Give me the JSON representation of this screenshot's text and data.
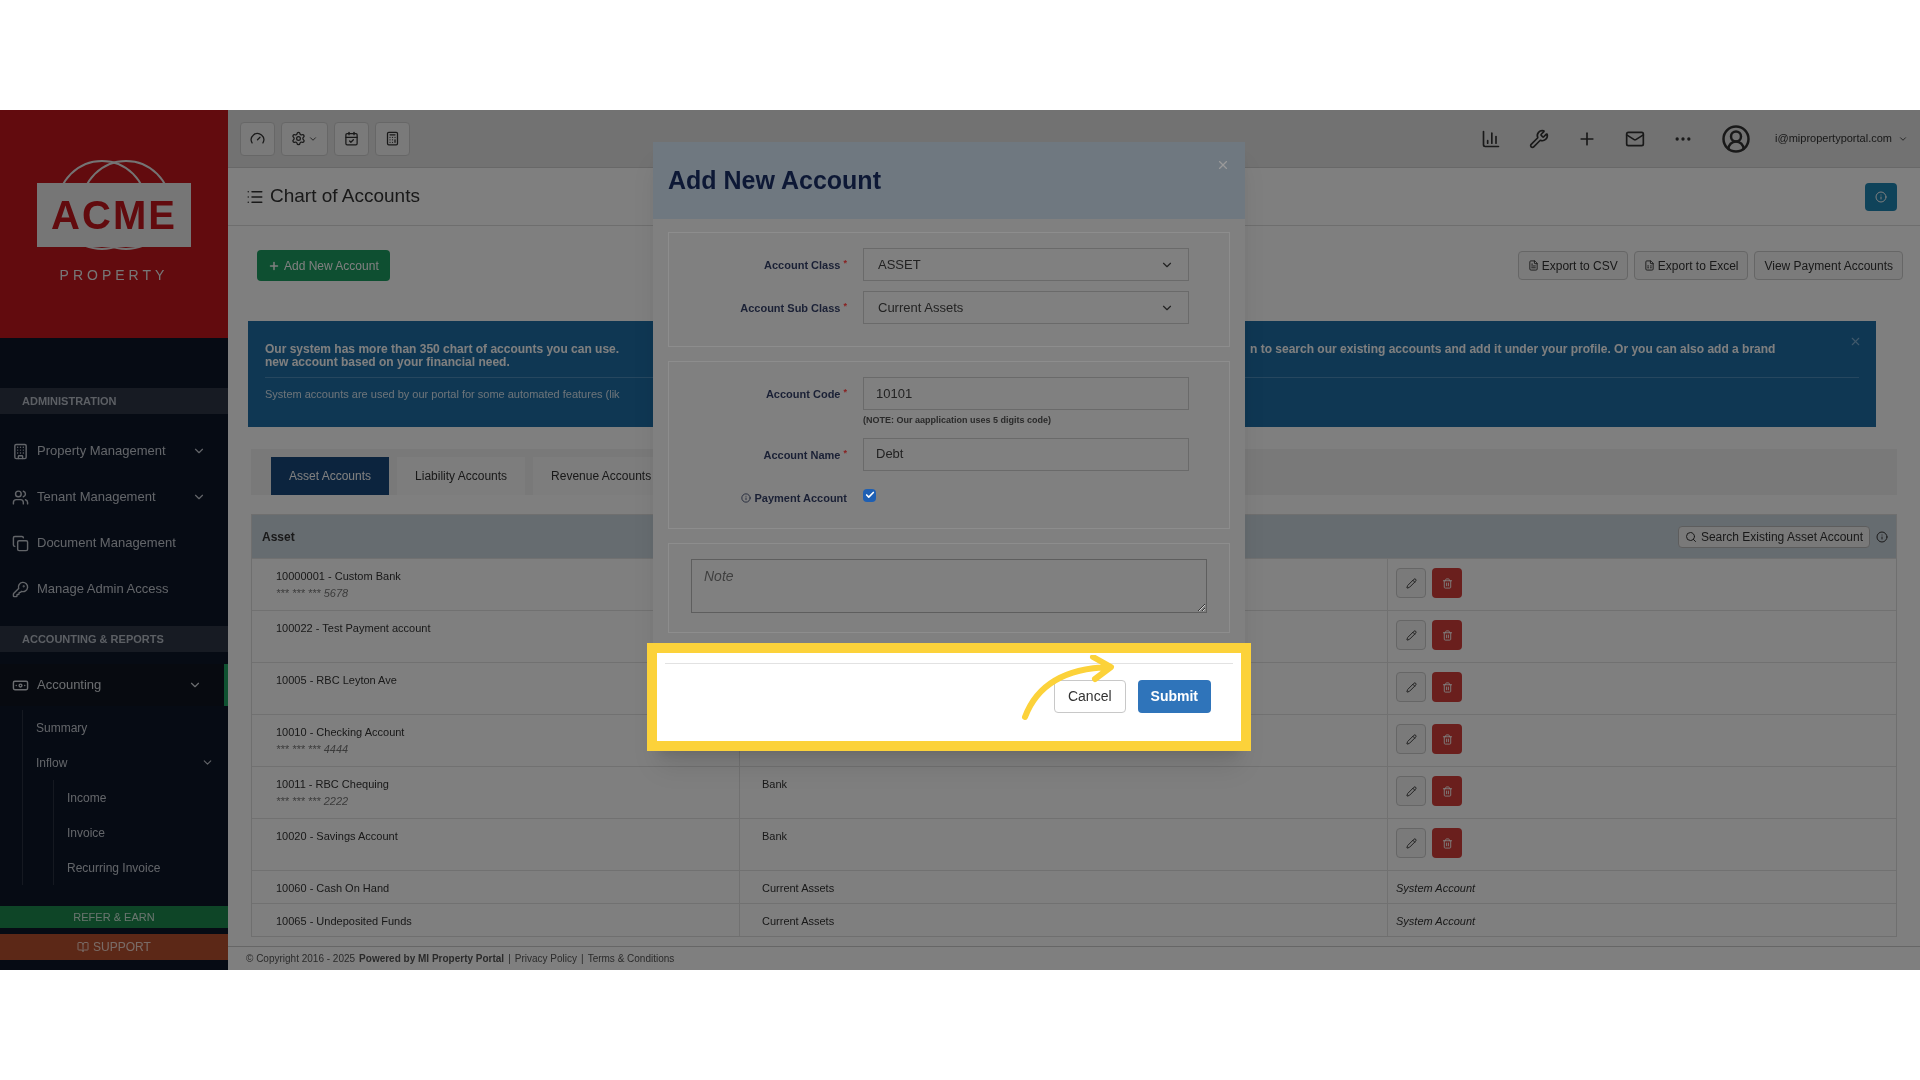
{
  "brand": {
    "name": "ACME",
    "tagline": "PROPERTY"
  },
  "sidebar": {
    "sections": [
      {
        "title": "ADMINISTRATION",
        "items": [
          {
            "label": "Property Management",
            "expandable": true,
            "selected": false
          },
          {
            "label": "Tenant Management",
            "expandable": true,
            "selected": false
          },
          {
            "label": "Document Management",
            "selected": false
          },
          {
            "label": "Manage Admin Access",
            "selected": false
          }
        ]
      },
      {
        "title": "ACCOUNTING & REPORTS",
        "items": [
          {
            "label": "Accounting",
            "expandable": true,
            "selected": true,
            "children": [
              {
                "label": "Summary"
              },
              {
                "label": "Inflow",
                "expandable": true,
                "children": [
                  {
                    "label": "Income"
                  },
                  {
                    "label": "Invoice"
                  },
                  {
                    "label": "Recurring Invoice"
                  }
                ]
              }
            ]
          }
        ]
      }
    ],
    "refer": "REFER & EARN",
    "support": "SUPPORT"
  },
  "topbar": {
    "user_email": "i@mipropertyportal.com"
  },
  "page": {
    "title": "Chart of Accounts",
    "add_button": "Add New Account",
    "actions": [
      "Export to CSV",
      "Export to Excel",
      "View Payment Accounts"
    ]
  },
  "banner": {
    "left_lines": [
      "Our system has more than 350 chart of accounts you can use.",
      "new account based on your financial need."
    ],
    "right_line": "n to search our existing accounts and add it under your profile. Or you can also add a brand",
    "note": "System accounts are used by our portal for some automated features (lik"
  },
  "tabs": [
    {
      "label": "Asset Accounts",
      "selected": true
    },
    {
      "label": "Liability Accounts",
      "selected": false
    },
    {
      "label": "Revenue Accounts",
      "selected": false
    }
  ],
  "table": {
    "columns": [
      "Asset"
    ],
    "search_button": "Search Existing Asset Account",
    "rows": [
      {
        "name": "10000001 - Custom Bank",
        "masked": "*** *** *** 5678",
        "kind": "editable"
      },
      {
        "name": "100022 - Test Payment account",
        "kind": "editable"
      },
      {
        "name": "10005 - RBC Leyton Ave",
        "kind": "editable"
      },
      {
        "name": "10010 - Checking Account",
        "masked": "*** *** *** 4444",
        "kind": "editable"
      },
      {
        "name": "10011 - RBC Chequing",
        "masked": "*** *** *** 2222",
        "sub_class": "Bank",
        "kind": "editable"
      },
      {
        "name": "10020 - Savings Account",
        "sub_class": "Bank",
        "kind": "editable"
      },
      {
        "name": "10060 - Cash On Hand",
        "sub_class": "Current Assets",
        "kind": "system",
        "note": "System Account"
      },
      {
        "name": "10065 - Undeposited Funds",
        "sub_class": "Current Assets",
        "kind": "system",
        "note": "System Account"
      }
    ]
  },
  "footer": {
    "copyright": "© Copyright 2016 - 2025",
    "powered": "Powered by MI Property Portal",
    "separator": "|",
    "links": [
      "Privacy Policy",
      "Terms & Conditions"
    ]
  },
  "modal": {
    "title": "Add New Account",
    "groups": [
      {
        "fields": [
          {
            "kind": "select",
            "label": "Account Class",
            "required_mark": "*",
            "value": "ASSET"
          },
          {
            "kind": "select",
            "label": "Account Sub Class",
            "required_mark": "*",
            "value": "Current Assets"
          }
        ]
      },
      {
        "fields": [
          {
            "kind": "text",
            "label": "Account Code",
            "required_mark": "*",
            "value": "10101",
            "help": "(NOTE: Our aapplication uses 5 digits code)"
          },
          {
            "kind": "text",
            "label": "Account Name",
            "required_mark": "*",
            "value": "Debt"
          },
          {
            "kind": "checkbox",
            "label": "Payment Account",
            "checked": true,
            "info": true
          }
        ]
      }
    ],
    "note": {
      "placeholder": "Note"
    },
    "buttons": [
      {
        "label": "Cancel",
        "kind": "secondary"
      },
      {
        "label": "Submit",
        "kind": "primary"
      }
    ]
  }
}
